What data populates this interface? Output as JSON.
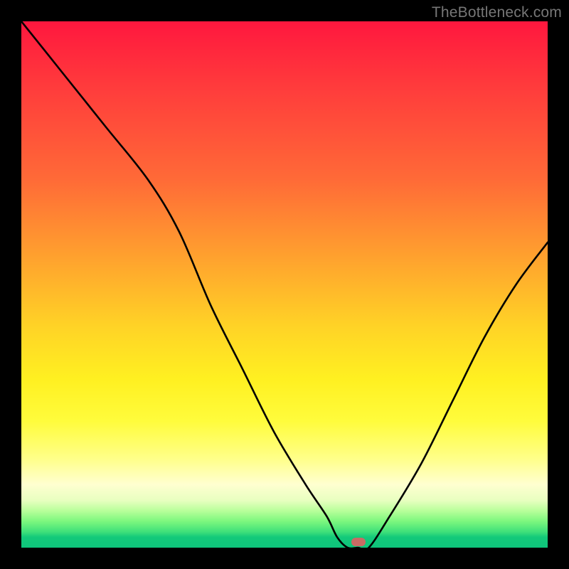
{
  "watermark": "TheBottleneck.com",
  "marker": {
    "x_frac": 0.64,
    "y_frac": 0.989
  },
  "chart_data": {
    "type": "line",
    "title": "",
    "xlabel": "",
    "ylabel": "",
    "xlim": [
      0,
      100
    ],
    "ylim": [
      0,
      100
    ],
    "series": [
      {
        "name": "bottleneck-curve",
        "x": [
          0,
          8,
          16,
          24,
          30,
          36,
          42,
          48,
          54,
          58,
          60,
          62,
          64,
          66,
          70,
          76,
          82,
          88,
          94,
          100
        ],
        "y": [
          100,
          90,
          80,
          70,
          60,
          46,
          34,
          22,
          12,
          6,
          2,
          0,
          0,
          0,
          6,
          16,
          28,
          40,
          50,
          58
        ]
      }
    ],
    "marker_point": {
      "x": 64,
      "y": 0
    },
    "gradient_description": "vertical red-to-green heat gradient (red=high bottleneck, green=no bottleneck)",
    "estimated_precision_note": "x and y are read as percentages of the plot area; values estimated from pixel positions"
  }
}
